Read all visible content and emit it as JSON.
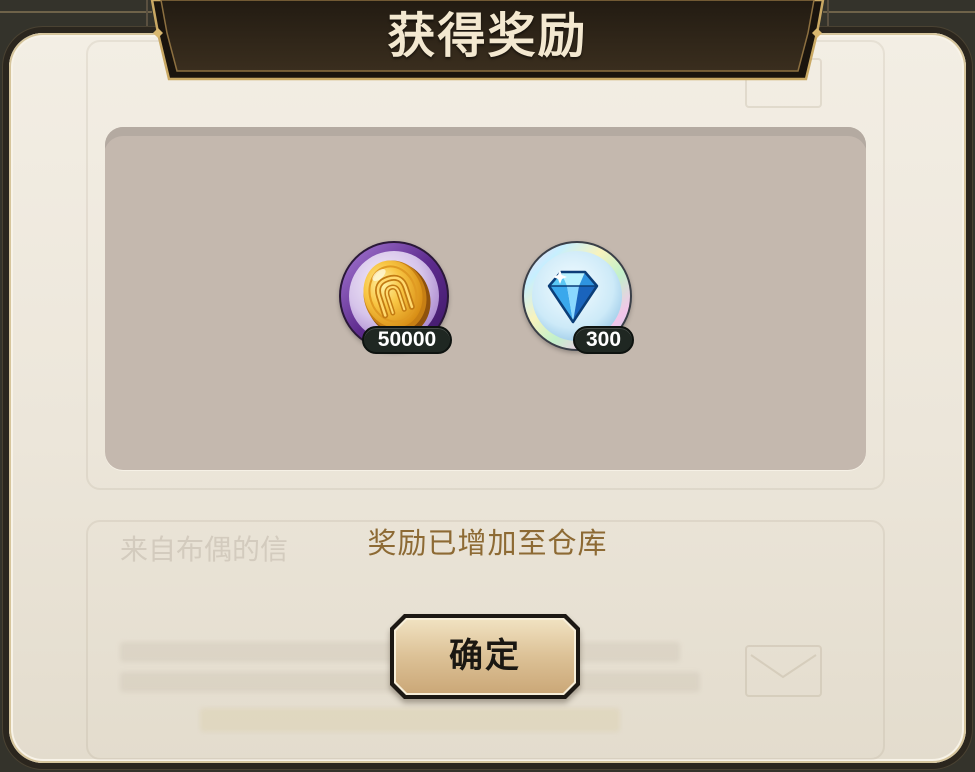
{
  "dialog": {
    "title": "获得奖励",
    "message": "奖励已增加至仓库",
    "confirm_label": "确定"
  },
  "rewards": [
    {
      "icon": "gold-coin-icon",
      "quantity": 50000
    },
    {
      "icon": "blue-diamond-icon",
      "quantity": 300
    }
  ],
  "background_mail": {
    "subject": "来自布偶的信",
    "icons": [
      "envelope-icon",
      "envelope-icon"
    ]
  },
  "colors": {
    "title_text": "#f3e8d0",
    "banner_fill": "#2a2117",
    "banner_trim": "#c9a863",
    "panel_fill": "#ece6da",
    "reward_area": "#c4b8ae",
    "message_text": "#8d6a34",
    "badge_fill": "#1f2722",
    "button_fill": "#dcc196",
    "button_text": "#1a1712",
    "coin_frame": "#5e2c8e"
  }
}
